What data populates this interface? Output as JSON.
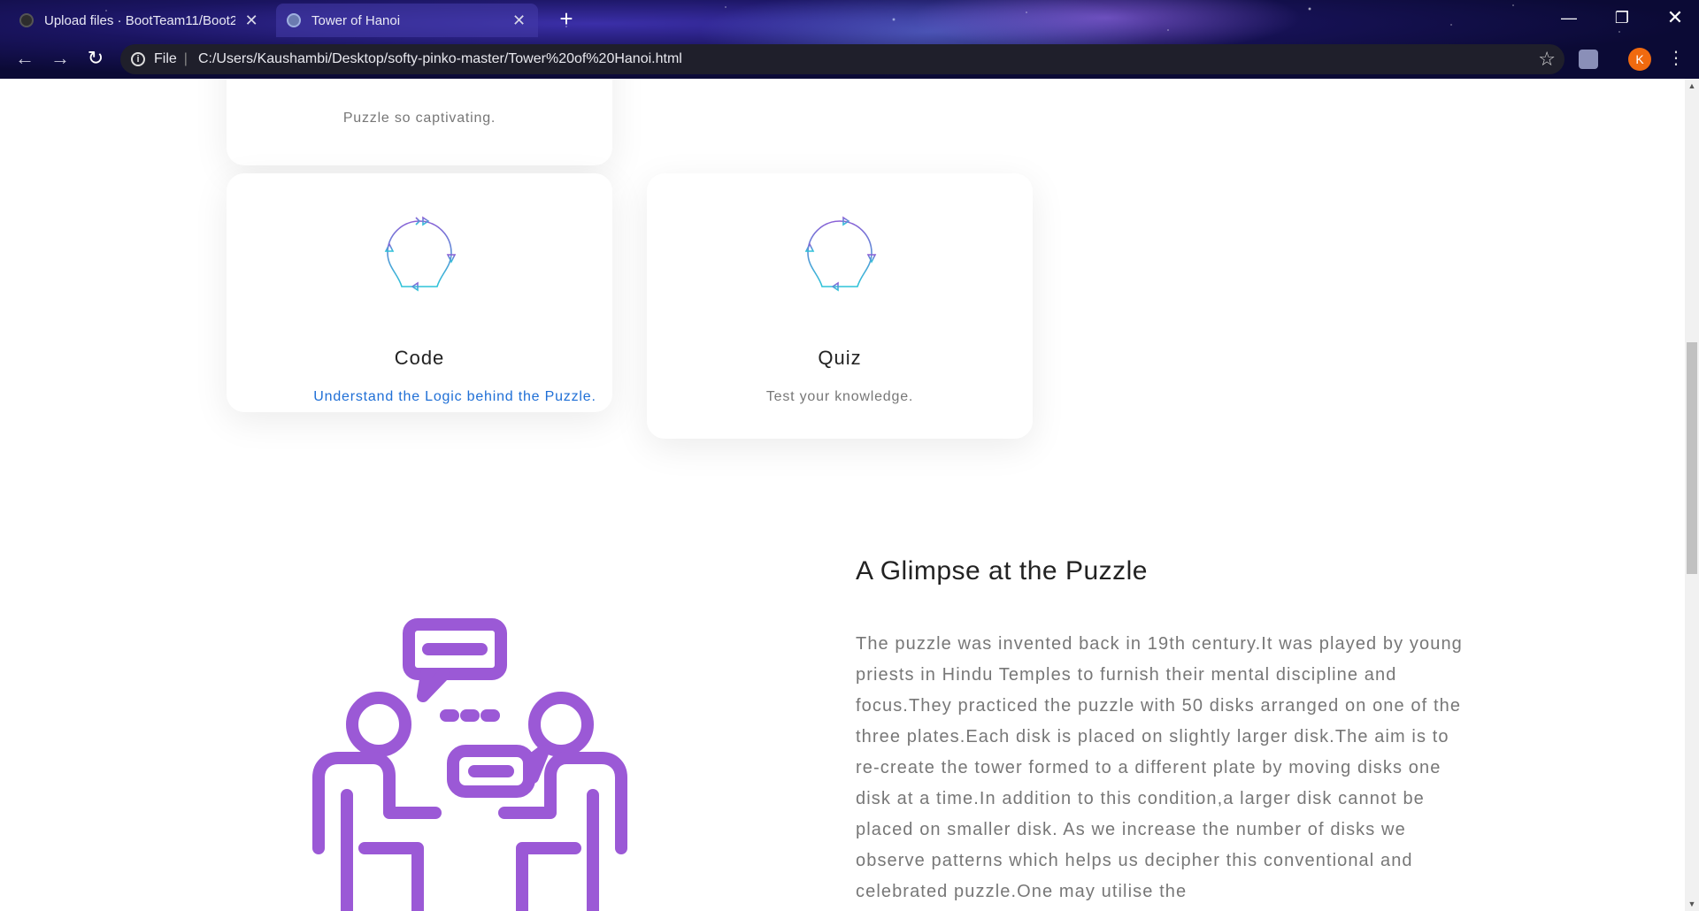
{
  "browser": {
    "tabs": [
      {
        "title": "Upload files · BootTeam11/Boot2",
        "active": false
      },
      {
        "title": "Tower of Hanoi",
        "active": true
      }
    ],
    "new_tab": "+",
    "address": {
      "scheme": "File",
      "url": "C:/Users/Kaushambi/Desktop/softy-pinko-master/Tower%20of%20Hanoi.html"
    },
    "profile_initial": "K",
    "accent_colors": {
      "profile": "#f06a0f",
      "link": "#1f6fd6",
      "illustration": "#9b59d6"
    }
  },
  "cards": {
    "top": {
      "desc": "Puzzle so captivating."
    },
    "code": {
      "title": "Code",
      "desc": "Understand the Logic behind the Puzzle.",
      "icon": "lightbulb-cycle-icon"
    },
    "quiz": {
      "title": "Quiz",
      "desc": "Test your knowledge.",
      "icon": "lightbulb-cycle-icon"
    }
  },
  "glimpse": {
    "title": "A Glimpse at the Puzzle",
    "text": "The puzzle was invented back in 19th century.It was played by young priests in Hindu Temples to furnish their mental discipline and focus.They practiced the puzzle with 50 disks arranged on one of the three plates.Each disk is placed on slightly larger disk.The aim is to re-create the tower formed to a different plate by moving disks one disk at a time.In addition to this condition,a larger disk cannot be placed on smaller disk. As we increase the number of disks we observe patterns which helps us decipher this conventional and celebrated puzzle.One may utilise the",
    "illustration": "people-discussion-icon"
  }
}
